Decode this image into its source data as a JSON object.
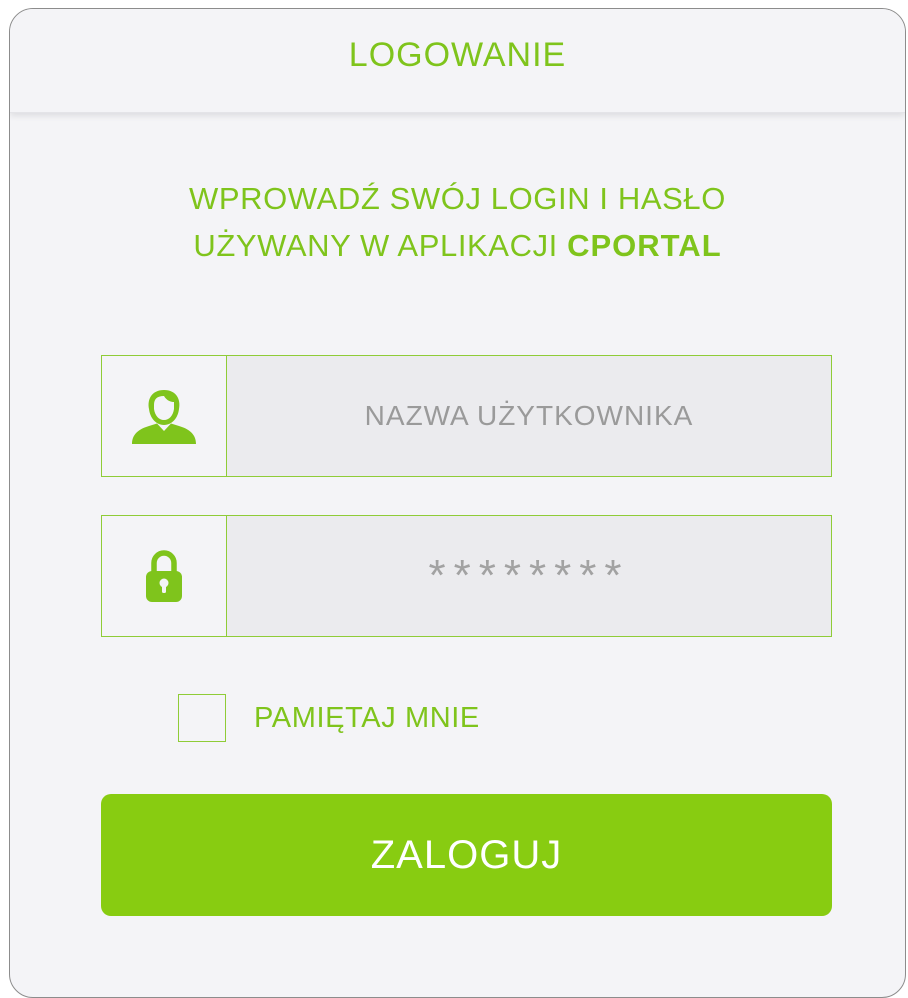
{
  "header": {
    "title": "LOGOWANIE"
  },
  "intro": {
    "line1": "WPROWADŹ SWÓJ LOGIN I HASŁO",
    "line2_prefix": "UŻYWANY W APLIKACJI ",
    "line2_brand": "CPORTAL"
  },
  "form": {
    "username": {
      "icon": "user-icon",
      "value": "",
      "placeholder": "NAZWA UŻYTKOWNIKA"
    },
    "password": {
      "icon": "lock-icon",
      "value": "********",
      "placeholder": ""
    },
    "remember": {
      "label": "PAMIĘTAJ MNIE",
      "checked": false
    },
    "submit_label": "ZALOGUJ"
  },
  "colors": {
    "accent": "#7fc41c",
    "button": "#88cc11",
    "background": "#f4f4f7",
    "field_fill": "#ebebee",
    "placeholder_text": "#9a9a9a"
  }
}
